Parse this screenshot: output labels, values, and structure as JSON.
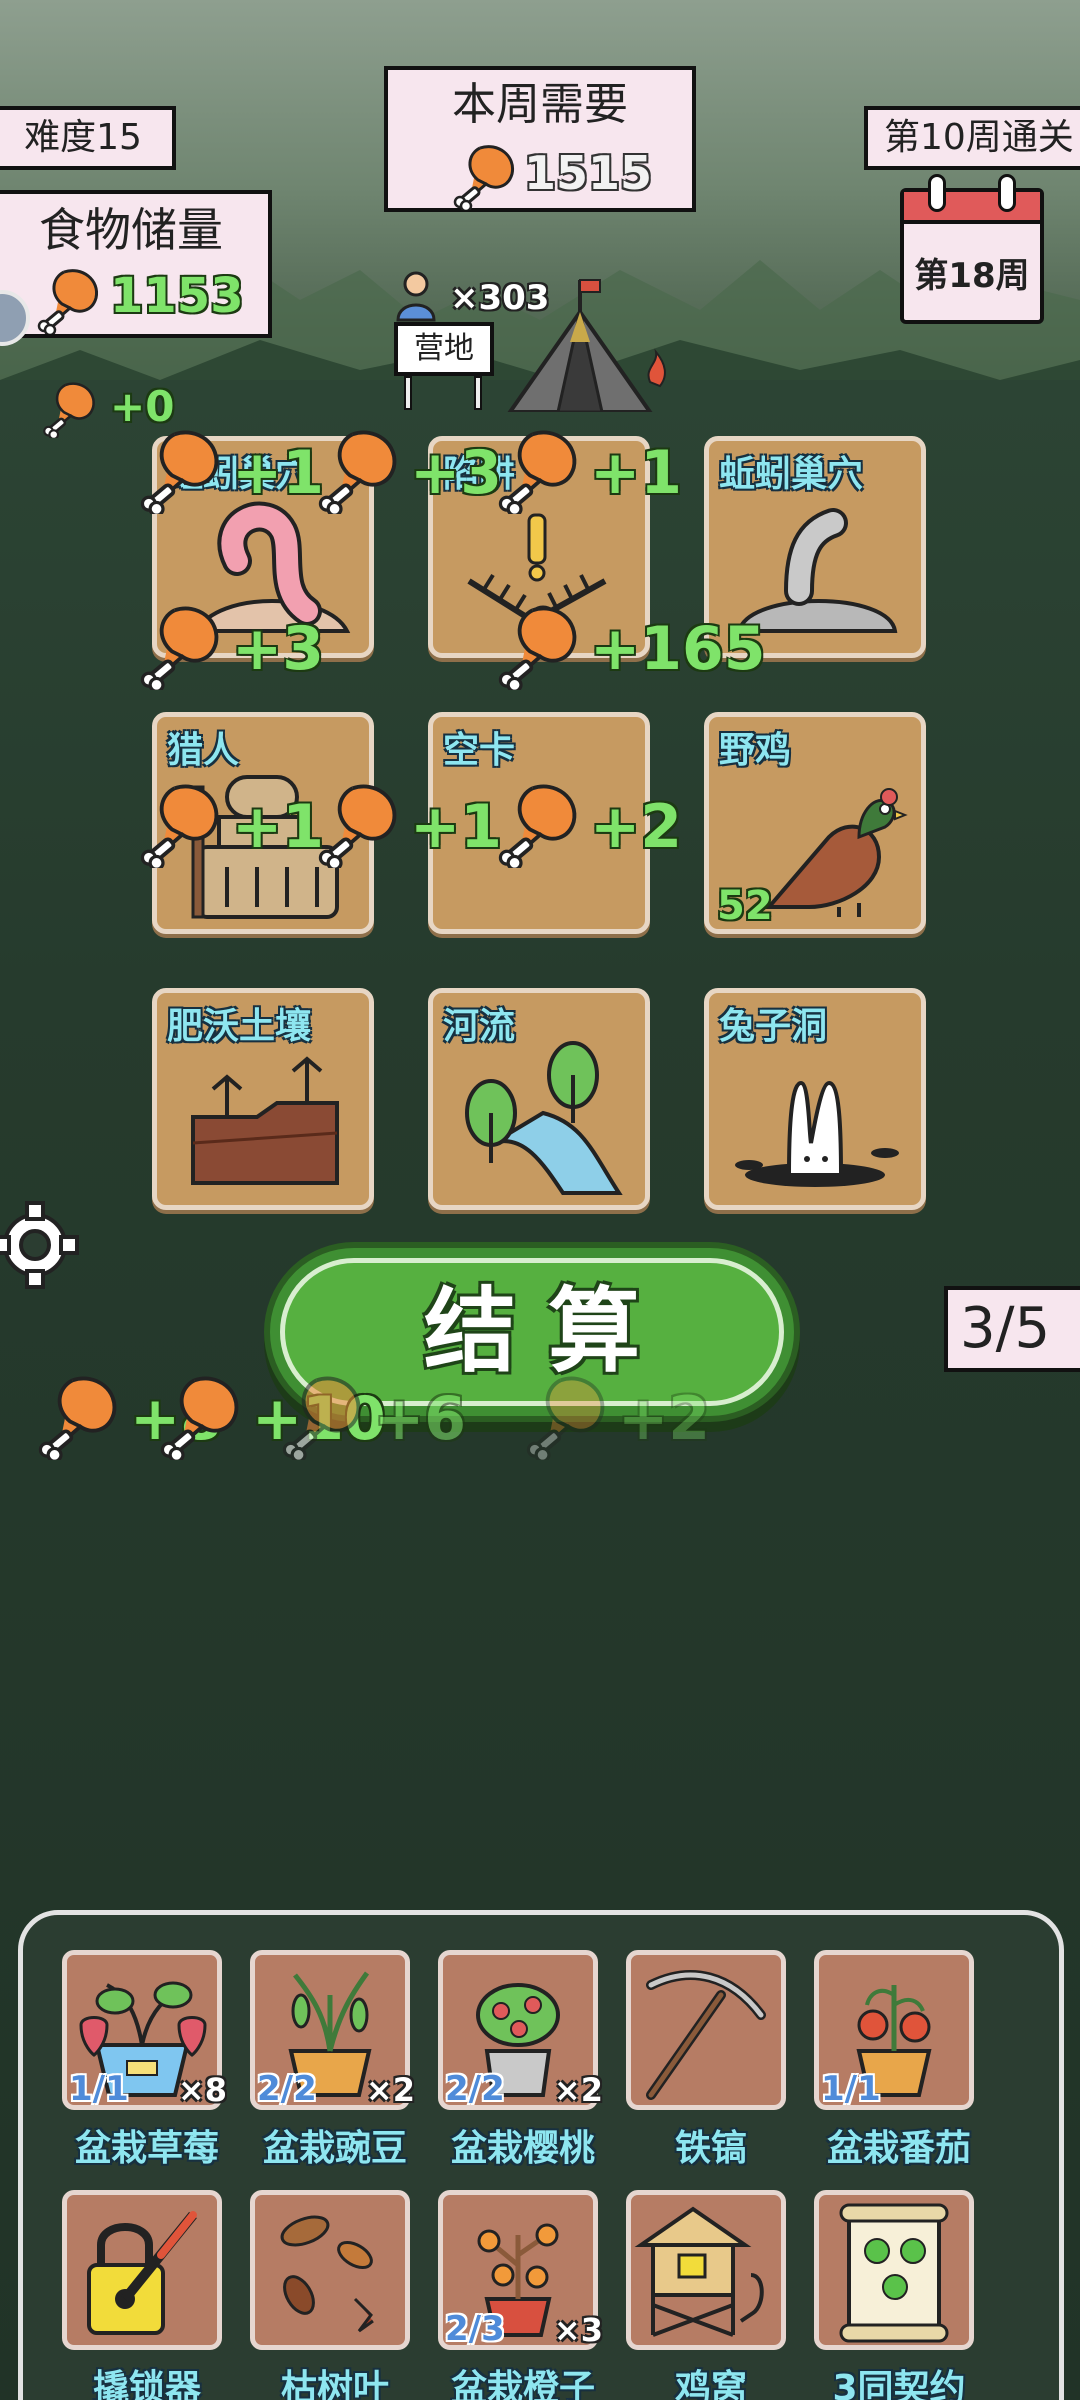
{
  "difficulty": "难度15",
  "weekly_need": {
    "title": "本周需要",
    "value": "1515"
  },
  "clear_goal": "第10周通关",
  "food_storage": {
    "title": "食物储量",
    "value": "1153"
  },
  "current_week": "第18周",
  "camp": {
    "population": "×303",
    "label": "营地"
  },
  "pending_gain": "+0",
  "grid_tiles": [
    {
      "name": "蚯蚓巢穴"
    },
    {
      "name": "陷阱"
    },
    {
      "name": "蚯蚓巢穴"
    },
    {
      "name": "猎人"
    },
    {
      "name": "空卡"
    },
    {
      "name": "野鸡",
      "counter": "52"
    },
    {
      "name": "肥沃土壤"
    },
    {
      "name": "河流"
    },
    {
      "name": "兔子洞"
    }
  ],
  "float_gains": [
    "+1",
    "+3",
    "+1",
    "+3",
    "+165",
    "+1",
    "+1",
    "+2"
  ],
  "bottom_gains": [
    "+8",
    "+10",
    "+6",
    "+2"
  ],
  "settle_button": "结 算",
  "rerolls": "3/5",
  "inventory": [
    {
      "name": "盆栽草莓",
      "uses": "1/1",
      "count": "×8",
      "icon": "strawberry-pot-icon"
    },
    {
      "name": "盆栽豌豆",
      "uses": "2/2",
      "count": "×2",
      "icon": "pea-pot-icon"
    },
    {
      "name": "盆栽樱桃",
      "uses": "2/2",
      "count": "×2",
      "icon": "cherry-pot-icon"
    },
    {
      "name": "铁镐",
      "uses": "",
      "count": "",
      "icon": "pickaxe-icon"
    },
    {
      "name": "盆栽番茄",
      "uses": "1/1",
      "count": "",
      "icon": "tomato-pot-icon"
    },
    {
      "name": "撬锁器",
      "uses": "",
      "count": "",
      "icon": "lockpick-icon"
    },
    {
      "name": "枯树叶",
      "uses": "",
      "count": "",
      "icon": "dry-leaves-icon"
    },
    {
      "name": "盆栽橙子",
      "uses": "2/3",
      "count": "×3",
      "icon": "orange-pot-icon"
    },
    {
      "name": "鸡窝",
      "uses": "",
      "count": "",
      "icon": "chicken-coop-icon"
    },
    {
      "name": "3同契约",
      "uses": "",
      "count": "",
      "icon": "contract-scroll-icon"
    }
  ],
  "colors": {
    "accent_green": "#7fe36a",
    "button_green": "#4aa33a",
    "tile_bg": "#c69a61"
  }
}
